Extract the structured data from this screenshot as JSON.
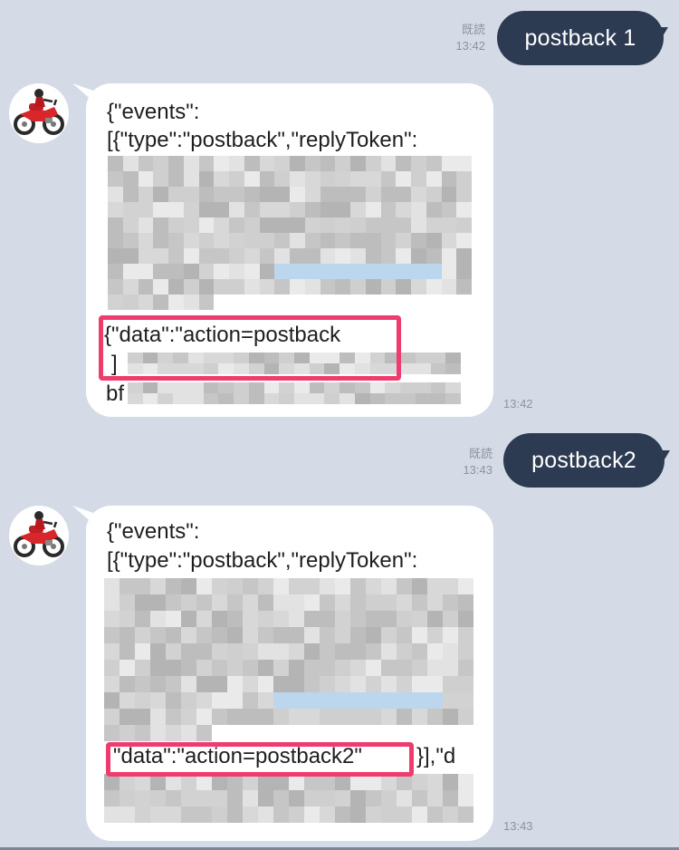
{
  "chat": {
    "messages": [
      {
        "direction": "outgoing",
        "text": "postback 1",
        "read_label": "既読",
        "time": "13:42"
      },
      {
        "direction": "incoming",
        "lines": [
          "{\"events\":",
          "[{\"type\":\"postback\",\"replyToken\":",
          "{\"data\":\"action=postback",
          "]",
          "bf"
        ],
        "time": "13:42"
      },
      {
        "direction": "outgoing",
        "text": "postback2",
        "read_label": "既読",
        "time": "13:43"
      },
      {
        "direction": "incoming",
        "lines": [
          "{\"events\":",
          "[{\"type\":\"postback\",\"replyToken\":",
          "\"data\":\"action=postback2\"",
          "}],\"d"
        ],
        "time": "13:43"
      }
    ]
  },
  "colors": {
    "background": "#d5dbe6",
    "outgoing_bubble": "#2c3a52",
    "incoming_bubble": "#ffffff",
    "highlight_box": "#ef3b6e",
    "blurred_link": "#bcd6ee"
  },
  "icons": {
    "avatar": "red-motorcycle-icon"
  }
}
